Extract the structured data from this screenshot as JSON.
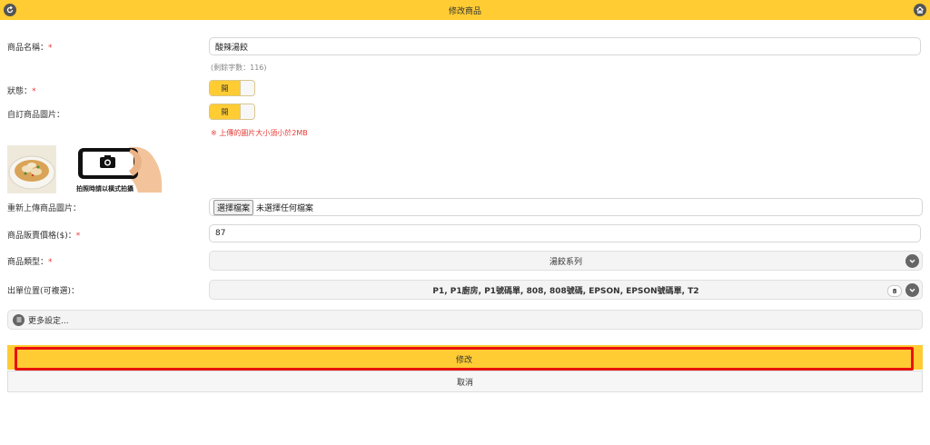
{
  "header": {
    "title": "修改商品",
    "back_icon": "back-arrow-icon",
    "home_icon": "home-icon",
    "bar_color": "#FFCC33"
  },
  "form": {
    "name_label": "商品名稱：",
    "name_value": "酸辣湯餃",
    "name_hint": "(剩餘字數：116)",
    "status_label": "狀態：",
    "status_toggle": "開",
    "custom_image_label": "自訂商品圖片：",
    "custom_image_toggle": "開",
    "image_warning": "※ 上傳的圖片大小須小於2MB",
    "camera_caption": "拍照時請以橫式拍攝",
    "reupload_label": "重新上傳商品圖片：",
    "file_button": "選擇檔案",
    "file_status": "未選擇任何檔案",
    "price_label": "商品販賣價格($)：",
    "price_value": "87",
    "type_label": "商品類型：",
    "type_value": "湯餃系列",
    "printer_label": "出單位置(可複選)：",
    "printer_value": "P1, P1廚房, P1號碼單, 808, 808號碼, EPSON, EPSON號碼單, T2",
    "printer_count": "8",
    "more_settings": "更多設定...",
    "required_mark": "*"
  },
  "actions": {
    "submit_label": "修改",
    "cancel_label": "取消"
  },
  "colors": {
    "accent": "#FFCC33",
    "required": "#e53935",
    "highlight_border": "#e8110e"
  }
}
